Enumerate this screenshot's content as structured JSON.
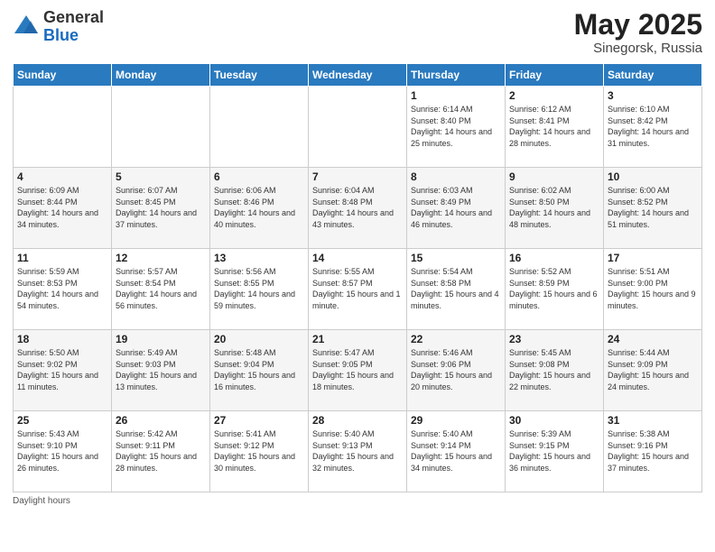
{
  "header": {
    "logo_general": "General",
    "logo_blue": "Blue",
    "month_year": "May 2025",
    "location": "Sinegorsk, Russia"
  },
  "weekdays": [
    "Sunday",
    "Monday",
    "Tuesday",
    "Wednesday",
    "Thursday",
    "Friday",
    "Saturday"
  ],
  "footer": {
    "daylight_hours": "Daylight hours"
  },
  "weeks": [
    [
      null,
      null,
      null,
      null,
      {
        "day": "1",
        "sunrise": "Sunrise: 6:14 AM",
        "sunset": "Sunset: 8:40 PM",
        "daylight": "Daylight: 14 hours and 25 minutes."
      },
      {
        "day": "2",
        "sunrise": "Sunrise: 6:12 AM",
        "sunset": "Sunset: 8:41 PM",
        "daylight": "Daylight: 14 hours and 28 minutes."
      },
      {
        "day": "3",
        "sunrise": "Sunrise: 6:10 AM",
        "sunset": "Sunset: 8:42 PM",
        "daylight": "Daylight: 14 hours and 31 minutes."
      }
    ],
    [
      {
        "day": "4",
        "sunrise": "Sunrise: 6:09 AM",
        "sunset": "Sunset: 8:44 PM",
        "daylight": "Daylight: 14 hours and 34 minutes."
      },
      {
        "day": "5",
        "sunrise": "Sunrise: 6:07 AM",
        "sunset": "Sunset: 8:45 PM",
        "daylight": "Daylight: 14 hours and 37 minutes."
      },
      {
        "day": "6",
        "sunrise": "Sunrise: 6:06 AM",
        "sunset": "Sunset: 8:46 PM",
        "daylight": "Daylight: 14 hours and 40 minutes."
      },
      {
        "day": "7",
        "sunrise": "Sunrise: 6:04 AM",
        "sunset": "Sunset: 8:48 PM",
        "daylight": "Daylight: 14 hours and 43 minutes."
      },
      {
        "day": "8",
        "sunrise": "Sunrise: 6:03 AM",
        "sunset": "Sunset: 8:49 PM",
        "daylight": "Daylight: 14 hours and 46 minutes."
      },
      {
        "day": "9",
        "sunrise": "Sunrise: 6:02 AM",
        "sunset": "Sunset: 8:50 PM",
        "daylight": "Daylight: 14 hours and 48 minutes."
      },
      {
        "day": "10",
        "sunrise": "Sunrise: 6:00 AM",
        "sunset": "Sunset: 8:52 PM",
        "daylight": "Daylight: 14 hours and 51 minutes."
      }
    ],
    [
      {
        "day": "11",
        "sunrise": "Sunrise: 5:59 AM",
        "sunset": "Sunset: 8:53 PM",
        "daylight": "Daylight: 14 hours and 54 minutes."
      },
      {
        "day": "12",
        "sunrise": "Sunrise: 5:57 AM",
        "sunset": "Sunset: 8:54 PM",
        "daylight": "Daylight: 14 hours and 56 minutes."
      },
      {
        "day": "13",
        "sunrise": "Sunrise: 5:56 AM",
        "sunset": "Sunset: 8:55 PM",
        "daylight": "Daylight: 14 hours and 59 minutes."
      },
      {
        "day": "14",
        "sunrise": "Sunrise: 5:55 AM",
        "sunset": "Sunset: 8:57 PM",
        "daylight": "Daylight: 15 hours and 1 minute."
      },
      {
        "day": "15",
        "sunrise": "Sunrise: 5:54 AM",
        "sunset": "Sunset: 8:58 PM",
        "daylight": "Daylight: 15 hours and 4 minutes."
      },
      {
        "day": "16",
        "sunrise": "Sunrise: 5:52 AM",
        "sunset": "Sunset: 8:59 PM",
        "daylight": "Daylight: 15 hours and 6 minutes."
      },
      {
        "day": "17",
        "sunrise": "Sunrise: 5:51 AM",
        "sunset": "Sunset: 9:00 PM",
        "daylight": "Daylight: 15 hours and 9 minutes."
      }
    ],
    [
      {
        "day": "18",
        "sunrise": "Sunrise: 5:50 AM",
        "sunset": "Sunset: 9:02 PM",
        "daylight": "Daylight: 15 hours and 11 minutes."
      },
      {
        "day": "19",
        "sunrise": "Sunrise: 5:49 AM",
        "sunset": "Sunset: 9:03 PM",
        "daylight": "Daylight: 15 hours and 13 minutes."
      },
      {
        "day": "20",
        "sunrise": "Sunrise: 5:48 AM",
        "sunset": "Sunset: 9:04 PM",
        "daylight": "Daylight: 15 hours and 16 minutes."
      },
      {
        "day": "21",
        "sunrise": "Sunrise: 5:47 AM",
        "sunset": "Sunset: 9:05 PM",
        "daylight": "Daylight: 15 hours and 18 minutes."
      },
      {
        "day": "22",
        "sunrise": "Sunrise: 5:46 AM",
        "sunset": "Sunset: 9:06 PM",
        "daylight": "Daylight: 15 hours and 20 minutes."
      },
      {
        "day": "23",
        "sunrise": "Sunrise: 5:45 AM",
        "sunset": "Sunset: 9:08 PM",
        "daylight": "Daylight: 15 hours and 22 minutes."
      },
      {
        "day": "24",
        "sunrise": "Sunrise: 5:44 AM",
        "sunset": "Sunset: 9:09 PM",
        "daylight": "Daylight: 15 hours and 24 minutes."
      }
    ],
    [
      {
        "day": "25",
        "sunrise": "Sunrise: 5:43 AM",
        "sunset": "Sunset: 9:10 PM",
        "daylight": "Daylight: 15 hours and 26 minutes."
      },
      {
        "day": "26",
        "sunrise": "Sunrise: 5:42 AM",
        "sunset": "Sunset: 9:11 PM",
        "daylight": "Daylight: 15 hours and 28 minutes."
      },
      {
        "day": "27",
        "sunrise": "Sunrise: 5:41 AM",
        "sunset": "Sunset: 9:12 PM",
        "daylight": "Daylight: 15 hours and 30 minutes."
      },
      {
        "day": "28",
        "sunrise": "Sunrise: 5:40 AM",
        "sunset": "Sunset: 9:13 PM",
        "daylight": "Daylight: 15 hours and 32 minutes."
      },
      {
        "day": "29",
        "sunrise": "Sunrise: 5:40 AM",
        "sunset": "Sunset: 9:14 PM",
        "daylight": "Daylight: 15 hours and 34 minutes."
      },
      {
        "day": "30",
        "sunrise": "Sunrise: 5:39 AM",
        "sunset": "Sunset: 9:15 PM",
        "daylight": "Daylight: 15 hours and 36 minutes."
      },
      {
        "day": "31",
        "sunrise": "Sunrise: 5:38 AM",
        "sunset": "Sunset: 9:16 PM",
        "daylight": "Daylight: 15 hours and 37 minutes."
      }
    ]
  ]
}
